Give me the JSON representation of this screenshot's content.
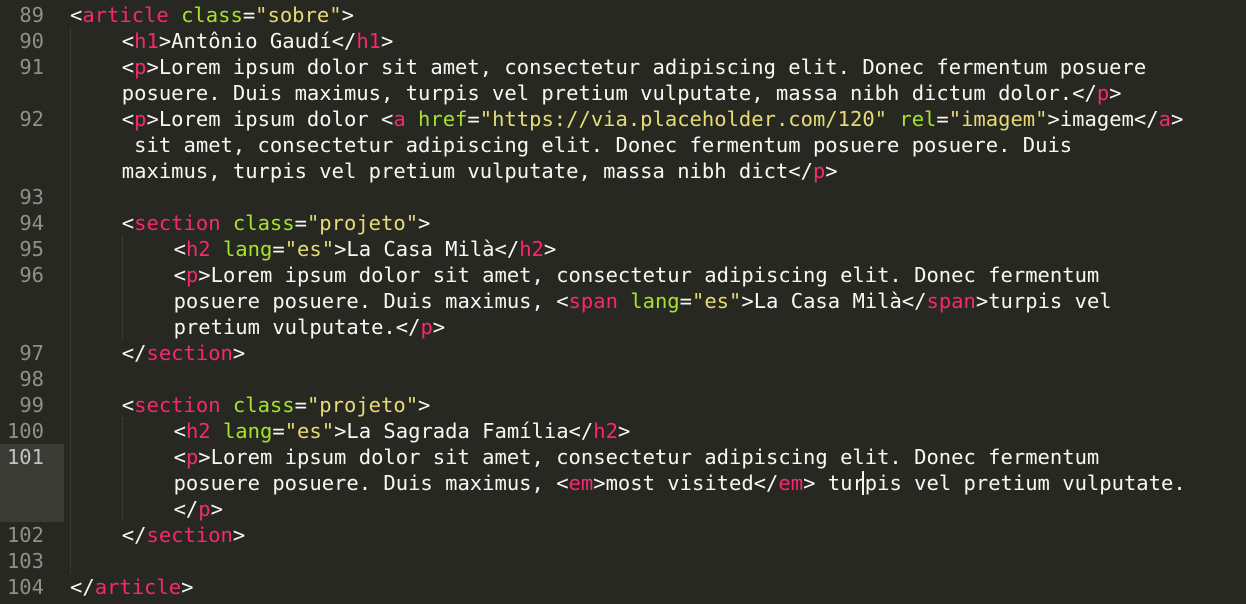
{
  "colors": {
    "background": "#272822",
    "text": "#f8f8f2",
    "tag": "#f92672",
    "attribute": "#a6e22e",
    "string": "#e6db74",
    "line_number": "#90908a",
    "active_line_gutter": "#3a3b35"
  },
  "line_numbers": [
    "89",
    "90",
    "91",
    "92",
    "93",
    "94",
    "95",
    "96",
    "97",
    "98",
    "99",
    "100",
    "101",
    "102",
    "103",
    "104"
  ],
  "active_line": "101",
  "code": [
    {
      "ln": "89",
      "tokens": [
        [
          "p",
          "<"
        ],
        [
          "t",
          "article"
        ],
        [
          "p",
          " "
        ],
        [
          "a",
          "class"
        ],
        [
          "p",
          "="
        ],
        [
          "s",
          "\"sobre\""
        ],
        [
          "p",
          ">"
        ]
      ]
    },
    {
      "ln": "90",
      "tokens": [
        [
          "p",
          "<"
        ],
        [
          "t",
          "h1"
        ],
        [
          "p",
          ">Antônio Gaudí</"
        ],
        [
          "t",
          "h1"
        ],
        [
          "p",
          ">"
        ]
      ]
    },
    {
      "ln": "91",
      "tokens": [
        [
          "p",
          "<"
        ],
        [
          "t",
          "p"
        ],
        [
          "p",
          ">Lorem ipsum dolor sit amet, consectetur adipiscing elit. Donec fermentum posuere"
        ]
      ]
    },
    {
      "ln": "",
      "tokens": [
        [
          "p",
          "posuere. Duis maximus, turpis vel pretium vulputate, massa nibh dictum dolor.</"
        ],
        [
          "t",
          "p"
        ],
        [
          "p",
          ">"
        ]
      ]
    },
    {
      "ln": "92",
      "tokens": [
        [
          "p",
          "<"
        ],
        [
          "t",
          "p"
        ],
        [
          "p",
          ">Lorem ipsum dolor <"
        ],
        [
          "t",
          "a"
        ],
        [
          "p",
          " "
        ],
        [
          "a",
          "href"
        ],
        [
          "p",
          "="
        ],
        [
          "s",
          "\"https://via.placeholder.com/120\""
        ],
        [
          "p",
          " "
        ],
        [
          "a",
          "rel"
        ],
        [
          "p",
          "="
        ],
        [
          "s",
          "\"imagem\""
        ],
        [
          "p",
          ">imagem</"
        ],
        [
          "t",
          "a"
        ],
        [
          "p",
          ">"
        ]
      ]
    },
    {
      "ln": "",
      "tokens": [
        [
          "p",
          " sit amet, consectetur adipiscing elit. Donec fermentum posuere posuere. Duis"
        ]
      ]
    },
    {
      "ln": "",
      "tokens": [
        [
          "p",
          "maximus, turpis vel pretium vulputate, massa nibh dict</"
        ],
        [
          "t",
          "p"
        ],
        [
          "p",
          ">"
        ]
      ]
    },
    {
      "ln": "93",
      "tokens": []
    },
    {
      "ln": "94",
      "tokens": [
        [
          "p",
          "<"
        ],
        [
          "t",
          "section"
        ],
        [
          "p",
          " "
        ],
        [
          "a",
          "class"
        ],
        [
          "p",
          "="
        ],
        [
          "s",
          "\"projeto\""
        ],
        [
          "p",
          ">"
        ]
      ]
    },
    {
      "ln": "95",
      "tokens": [
        [
          "p",
          "<"
        ],
        [
          "t",
          "h2"
        ],
        [
          "p",
          " "
        ],
        [
          "a",
          "lang"
        ],
        [
          "p",
          "="
        ],
        [
          "s",
          "\"es\""
        ],
        [
          "p",
          ">La Casa Milà</"
        ],
        [
          "t",
          "h2"
        ],
        [
          "p",
          ">"
        ]
      ]
    },
    {
      "ln": "96",
      "tokens": [
        [
          "p",
          "<"
        ],
        [
          "t",
          "p"
        ],
        [
          "p",
          ">Lorem ipsum dolor sit amet, consectetur adipiscing elit. Donec fermentum"
        ]
      ]
    },
    {
      "ln": "",
      "tokens": [
        [
          "p",
          "posuere posuere. Duis maximus, <"
        ],
        [
          "t",
          "span"
        ],
        [
          "p",
          " "
        ],
        [
          "a",
          "lang"
        ],
        [
          "p",
          "="
        ],
        [
          "s",
          "\"es\""
        ],
        [
          "p",
          ">La Casa Milà</"
        ],
        [
          "t",
          "span"
        ],
        [
          "p",
          ">turpis vel"
        ]
      ]
    },
    {
      "ln": "",
      "tokens": [
        [
          "p",
          "pretium vulputate.</"
        ],
        [
          "t",
          "p"
        ],
        [
          "p",
          ">"
        ]
      ]
    },
    {
      "ln": "97",
      "tokens": [
        [
          "p",
          "</"
        ],
        [
          "t",
          "section"
        ],
        [
          "p",
          ">"
        ]
      ]
    },
    {
      "ln": "98",
      "tokens": []
    },
    {
      "ln": "99",
      "tokens": [
        [
          "p",
          "<"
        ],
        [
          "t",
          "section"
        ],
        [
          "p",
          " "
        ],
        [
          "a",
          "class"
        ],
        [
          "p",
          "="
        ],
        [
          "s",
          "\"projeto\""
        ],
        [
          "p",
          ">"
        ]
      ]
    },
    {
      "ln": "100",
      "tokens": [
        [
          "p",
          "<"
        ],
        [
          "t",
          "h2"
        ],
        [
          "p",
          " "
        ],
        [
          "a",
          "lang"
        ],
        [
          "p",
          "="
        ],
        [
          "s",
          "\"es\""
        ],
        [
          "p",
          ">La Sagrada Família</"
        ],
        [
          "t",
          "h2"
        ],
        [
          "p",
          ">"
        ]
      ]
    },
    {
      "ln": "101",
      "tokens": [
        [
          "p",
          "<"
        ],
        [
          "t",
          "p"
        ],
        [
          "p",
          ">Lorem ipsum dolor sit amet, consectetur adipiscing elit. Donec fermentum"
        ]
      ]
    },
    {
      "ln": "",
      "tokens": [
        [
          "p",
          "posuere posuere. Duis maximus, <"
        ],
        [
          "t",
          "em"
        ],
        [
          "p",
          ">most visited</"
        ],
        [
          "t",
          "em"
        ],
        [
          "p",
          "> turpis vel pretium vulputate."
        ]
      ]
    },
    {
      "ln": "",
      "tokens": [
        [
          "p",
          "</"
        ],
        [
          "t",
          "p"
        ],
        [
          "p",
          ">"
        ]
      ]
    },
    {
      "ln": "102",
      "tokens": [
        [
          "p",
          "</"
        ],
        [
          "t",
          "section"
        ],
        [
          "p",
          ">"
        ]
      ]
    },
    {
      "ln": "103",
      "tokens": []
    },
    {
      "ln": "104",
      "tokens": [
        [
          "p",
          "</"
        ],
        [
          "t",
          "article"
        ],
        [
          "p",
          ">"
        ]
      ]
    }
  ]
}
